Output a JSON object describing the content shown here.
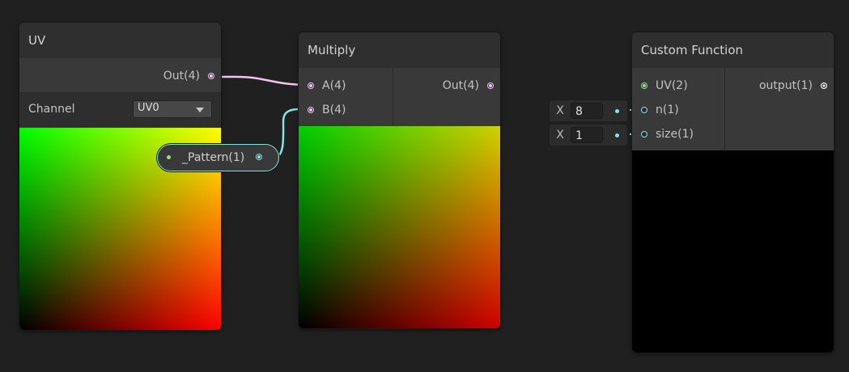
{
  "colors": {
    "canvas_bg": "#202020",
    "node_body": "#393939",
    "node_title": "#2f2f2f",
    "vector4_wire": "#f4c2f0",
    "vector2_wire": "#97e092",
    "float_wire": "#84e4e7"
  },
  "uv_node": {
    "title": "UV",
    "output_label": "Out(4)",
    "channel_label": "Channel",
    "channel_value": "UV0"
  },
  "pattern_property": {
    "label": "_Pattern(1)"
  },
  "multiply_node": {
    "title": "Multiply",
    "input_a": "A(4)",
    "input_b": "B(4)",
    "output_label": "Out(4)"
  },
  "custom_function_node": {
    "title": "Custom Function",
    "input_uv": "UV(2)",
    "input_n": "n(1)",
    "input_size": "size(1)",
    "output_label": "output(1)"
  },
  "inline_fields": {
    "n": {
      "axis": "X",
      "value": "8"
    },
    "size": {
      "axis": "X",
      "value": "1"
    }
  }
}
